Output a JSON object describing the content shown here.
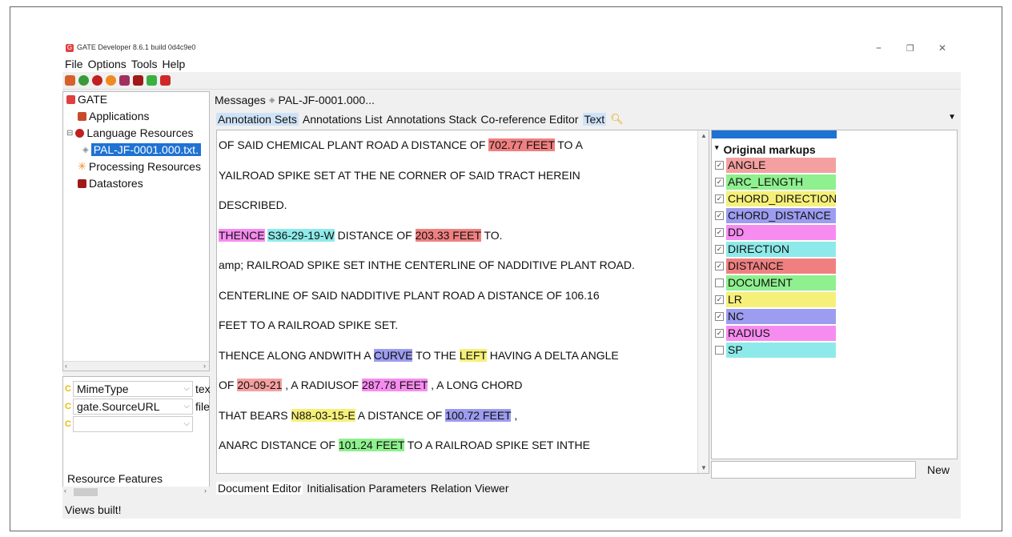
{
  "window": {
    "title": "GATE Developer 8.6.1 build 0d4c9e0",
    "controls": [
      "–",
      "❐",
      "✕"
    ]
  },
  "menu": [
    "File",
    "Options",
    "Tools",
    "Help"
  ],
  "toolbar_icons": [
    "new-application-icon",
    "load-resource-icon",
    "language-resource-icon",
    "processing-resource-icon",
    "new-datastore-icon",
    "datastore-icon",
    "plugin-manager-icon",
    "annie-icon"
  ],
  "tree": {
    "root": "GATE",
    "applications": "Applications",
    "language_resources": "Language Resources",
    "document": "PAL-JF-0001.000.txt.",
    "processing_resources": "Processing Resources",
    "datastores": "Datastores"
  },
  "features": {
    "rows": [
      {
        "name": "MimeType",
        "value": "tex"
      },
      {
        "name": "gate.SourceURL",
        "value": "file"
      },
      {
        "name": "",
        "value": ""
      }
    ],
    "label": "Resource Features"
  },
  "status": "Views built!",
  "top_tabs": {
    "messages": "Messages",
    "document": "PAL-JF-0001.000..."
  },
  "view_tabs": [
    "Annotation Sets",
    "Annotations List",
    "Annotations Stack",
    "Co-reference Editor",
    "Text"
  ],
  "text_lines": [
    [
      {
        "t": "OF SAID CHEMICAL PLANT ROAD A DISTANCE OF "
      },
      {
        "t": "702.77 FEET",
        "c": "#f08080"
      },
      {
        "t": " TO A"
      }
    ],
    [
      {
        "t": "YAILROAD SPIKE SET AT THE NE CORNER OF SAID TRACT HEREIN"
      }
    ],
    [
      {
        "t": "DESCRIBED."
      }
    ],
    [
      {
        "t": "THENCE",
        "c": "#f78cf0"
      },
      {
        "t": " "
      },
      {
        "t": "S36-29-19-W",
        "c": "#8eeaea"
      },
      {
        "t": " DISTANCE OF "
      },
      {
        "t": "203.33 FEET",
        "c": "#f08080"
      },
      {
        "t": " TO."
      }
    ],
    [
      {
        "t": "amp; RAILROAD SPIKE SET INTHE CENTERLINE OF NADDITIVE PLANT ROAD."
      }
    ],
    [
      {
        "t": "CENTERLINE OF SAID NADDITIVE PLANT ROAD A DISTANCE OF 106.16"
      }
    ],
    [
      {
        "t": "FEET TO A RAILROAD SPIKE SET."
      }
    ],
    [
      {
        "t": "THENCE ALONG ANDWITH A "
      },
      {
        "t": "CURVE",
        "c": "#9c9cf0"
      },
      {
        "t": " TO THE "
      },
      {
        "t": "LEFT",
        "c": "#f6f07a"
      },
      {
        "t": " HAVING A DELTA ANGLE"
      }
    ],
    [
      {
        "t": "OF "
      },
      {
        "t": "20-09-21",
        "c": "#f5a0a0"
      },
      {
        "t": " , A RADIUSOF "
      },
      {
        "t": "287.78 FEET",
        "c": "#f78cf0"
      },
      {
        "t": " , A LONG CHORD"
      }
    ],
    [
      {
        "t": "THAT BEARS "
      },
      {
        "t": "N88-03-15-E",
        "c": "#f6f07a"
      },
      {
        "t": " A DISTANCE OF "
      },
      {
        "t": "100.72 FEET",
        "c": "#9c9cf0"
      },
      {
        "t": " ,"
      }
    ],
    [
      {
        "t": "ANARC DISTANCE OF "
      },
      {
        "t": "101.24 FEET",
        "c": "#8ef08e"
      },
      {
        "t": " TO A RAILROAD SPIKE SET INTHE"
      }
    ]
  ],
  "annotation_sets": {
    "header": "Original markups",
    "items": [
      {
        "name": "ANGLE",
        "checked": true,
        "color": "#f5a0a0"
      },
      {
        "name": "ARC_LENGTH",
        "checked": true,
        "color": "#8ef08e"
      },
      {
        "name": "CHORD_DIRECTION",
        "checked": true,
        "color": "#f6f07a"
      },
      {
        "name": "CHORD_DISTANCE",
        "checked": true,
        "color": "#9c9cf0"
      },
      {
        "name": "DD",
        "checked": true,
        "color": "#f78cf0"
      },
      {
        "name": "DIRECTION",
        "checked": true,
        "color": "#8eeaea"
      },
      {
        "name": "DISTANCE",
        "checked": true,
        "color": "#f08080"
      },
      {
        "name": "DOCUMENT",
        "checked": false,
        "color": "#8ef08e"
      },
      {
        "name": "LR",
        "checked": true,
        "color": "#f6f07a"
      },
      {
        "name": "NC",
        "checked": true,
        "color": "#9c9cf0"
      },
      {
        "name": "RADIUS",
        "checked": true,
        "color": "#f78cf0"
      },
      {
        "name": "SP",
        "checked": false,
        "color": "#8eeaea"
      }
    ],
    "new_button": "New"
  },
  "bottom_tabs": [
    "Document Editor",
    "Initialisation Parameters",
    "Relation Viewer"
  ]
}
